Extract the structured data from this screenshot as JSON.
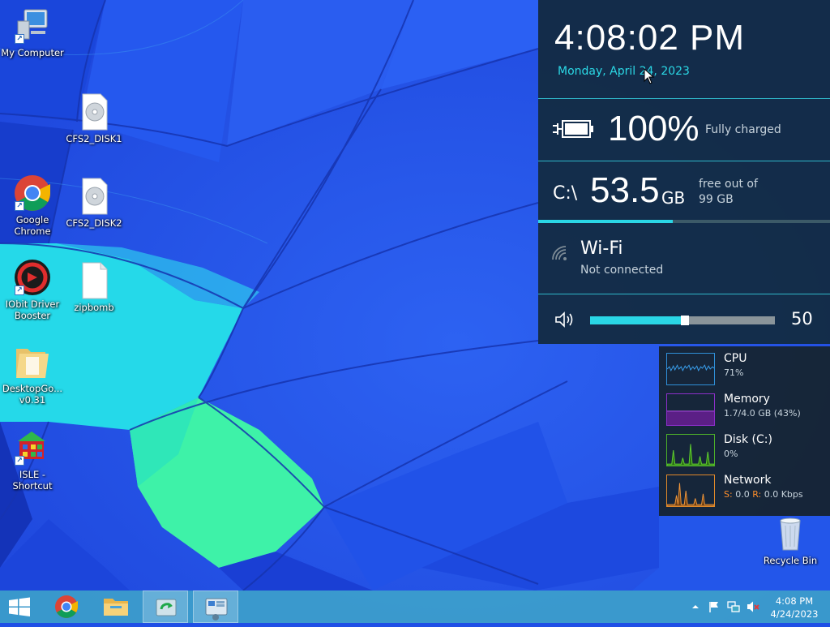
{
  "desktop": {
    "icons": [
      {
        "label": "My Computer"
      },
      {
        "label": "CFS2_DISK1"
      },
      {
        "label": "Google Chrome"
      },
      {
        "label": "CFS2_DISK2"
      },
      {
        "label": "IObit Driver Booster"
      },
      {
        "label": "zipbomb"
      },
      {
        "label": "DesktopGo... v0.31"
      },
      {
        "label": "ISLE - Shortcut"
      },
      {
        "label": "Recycle Bin"
      }
    ]
  },
  "sidebar": {
    "clock": "4:08:02 PM",
    "date": "Monday, April 24, 2023",
    "battery": {
      "percent_text": "100%",
      "status": "Fully charged",
      "level": 1.0
    },
    "drive": {
      "label": "C:\\",
      "value": "53.5",
      "unit": "GB",
      "free_line1": "free out of",
      "free_line2": "99 GB",
      "used_fraction": 0.46
    },
    "wifi": {
      "name": "Wi-Fi",
      "status": "Not connected"
    },
    "volume": {
      "value": "50",
      "level": 0.5
    }
  },
  "perf": {
    "cpu": {
      "name": "CPU",
      "value": "71%",
      "color": "#2f8fd8"
    },
    "memory": {
      "name": "Memory",
      "value": "1.7/4.0 GB (43%)",
      "color": "#8b2fc9"
    },
    "disk": {
      "name": "Disk (C:)",
      "value": "0%",
      "color": "#4caf2a"
    },
    "network": {
      "name": "Network",
      "s_label": "S:",
      "s_value": "0.0",
      "r_label": "R:",
      "r_value": "0.0 Kbps",
      "color": "#e0892a"
    }
  },
  "taskbar": {
    "time": "4:08 PM",
    "date": "4/24/2023",
    "buttons": [
      "start",
      "chrome",
      "file-explorer",
      "app-green",
      "app-blue"
    ]
  },
  "colors": {
    "accent": "#2ad6e6",
    "sidebar_bg": "#122a3e",
    "taskbar": "#40aac8"
  }
}
